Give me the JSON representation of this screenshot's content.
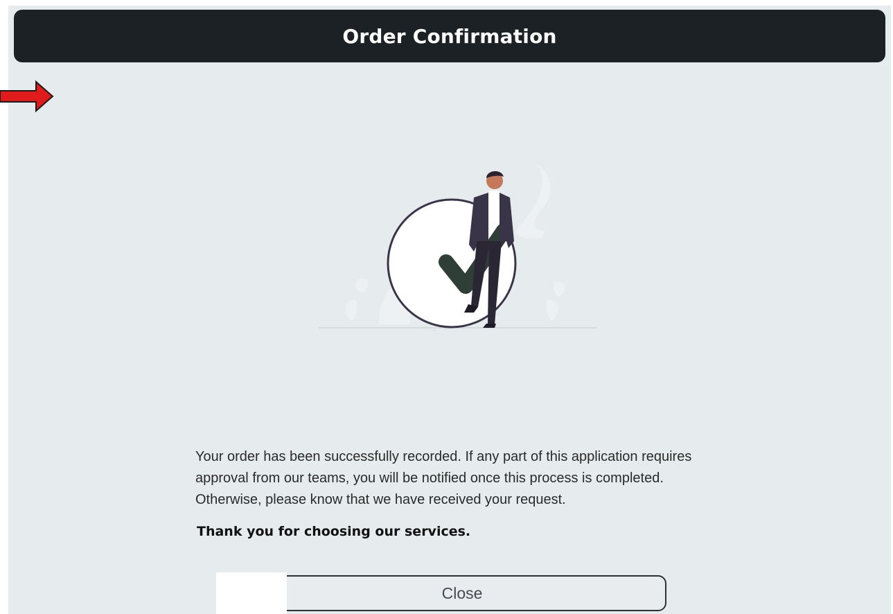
{
  "dialog": {
    "title": "Order Confirmation",
    "message": "Your order has been successfully recorded. If any part of this application requires approval from our teams, you will be notified once this process is completed. Otherwise, please know that we have received your request.",
    "thanks": "Thank you for choosing our services.",
    "close_label": "Close"
  },
  "annotation": {
    "arrow_color": "#e01b1b",
    "arrow_icon": "right-arrow-icon"
  },
  "illustration": {
    "name": "order-success-illustration",
    "accent_color": "#2f3e36"
  }
}
